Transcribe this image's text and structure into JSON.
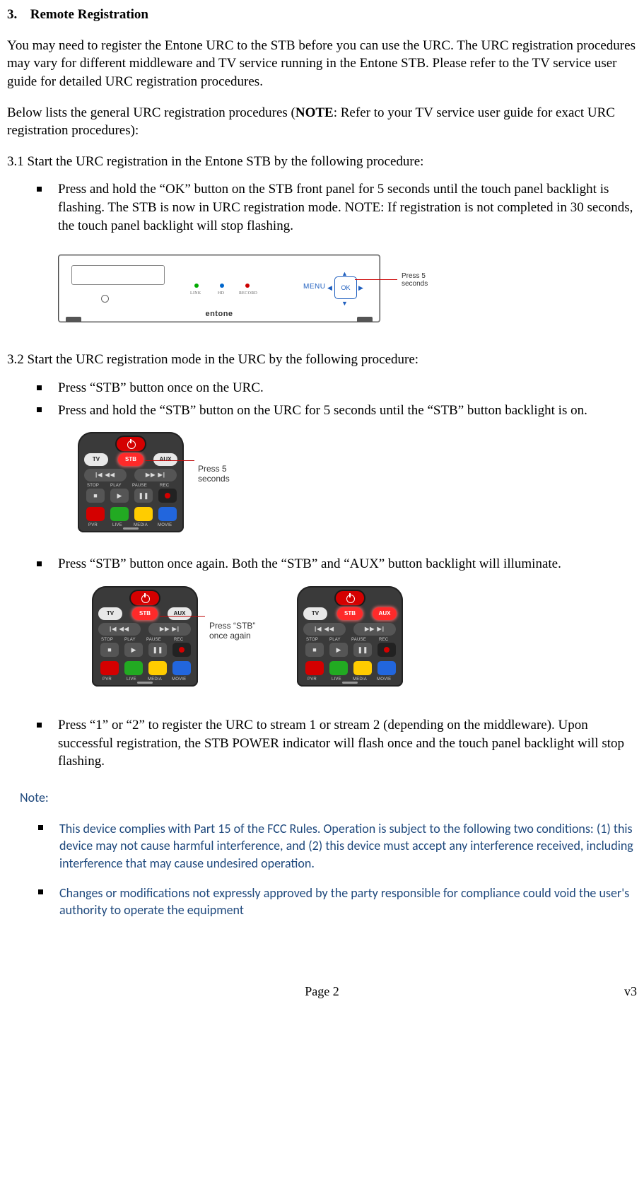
{
  "section": {
    "number": "3.",
    "title": "Remote Registration"
  },
  "p1": "You may need to register the Entone URC to the STB before you can use the URC. The URC registration procedures may vary for different middleware and TV service running in the Entone STB. Please refer to the TV service user guide for detailed URC registration procedures.",
  "p2a": "Below lists the general URC registration procedures (",
  "p2bold": "NOTE",
  "p2b": ": Refer to your TV service user guide for exact URC registration procedures):",
  "s31": "3.1 Start the URC registration in the Entone STB by the following procedure:",
  "s31_b1": "Press and hold the “OK” button on the STB front panel for 5 seconds until the touch panel backlight is flashing. The STB is now in URC registration mode. NOTE: If registration is not completed in 30 seconds, the touch panel backlight will stop flashing.",
  "stb": {
    "menu": "MENU",
    "ok": "OK",
    "led1": "LINK",
    "led2": "HD",
    "led3": "RECORD",
    "brand": "entone",
    "callout": "Press 5\nseconds"
  },
  "s32": "3.2 Start the URC registration mode in the URC by the following procedure:",
  "s32_b1": "Press “STB” button once on the URC.",
  "s32_b2": "Press and hold the “STB” button on the URC for 5 seconds until the “STB” button backlight is on.",
  "s32_b3": "Press “STB” button once again. Both the “STB” and “AUX” button backlight will illuminate.",
  "s32_b4": "Press “1” or “2” to register the URC to stream 1 or stream 2 (depending on the middleware). Upon successful registration, the STB POWER indicator will flash once and the touch panel backlight will stop flashing.",
  "remote": {
    "tv": "TV",
    "stb": "STB",
    "aux": "AUX",
    "row_lbls": [
      "STOP",
      "PLAY",
      "PAUSE",
      "REC"
    ],
    "col_lbls": [
      "PVR",
      "LIVE",
      "MEDIA",
      "MOVIE"
    ],
    "callout1": "Press 5\nseconds",
    "callout2": "Press “STB”\nonce again"
  },
  "note": {
    "label": "Note:",
    "n1": "This device complies with Part 15 of the FCC Rules. Operation is subject to the following two conditions: (1) this device may not cause harmful interference, and (2) this device must accept any interference received, including interference that may cause undesired operation.",
    "n2": "Changes or modifications not expressly approved by the party responsible for compliance could void the user's authority to operate the equipment"
  },
  "footer": {
    "page": "Page 2",
    "ver": "v3"
  }
}
